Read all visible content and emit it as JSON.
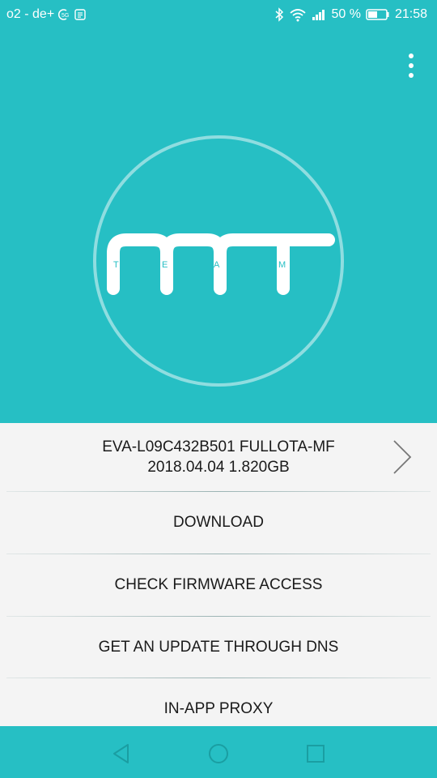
{
  "status_bar": {
    "carrier": "o2 - de+",
    "battery_percent": "50 %",
    "time": "21:58",
    "icons": [
      "hd-call-icon",
      "notification-icon",
      "bluetooth-icon",
      "wifi-icon",
      "signal-icon",
      "battery-icon"
    ]
  },
  "hero": {
    "logo_text": "MT",
    "logo_subtext": [
      "T",
      "E",
      "A",
      "M"
    ],
    "background_color": "#26bfc4"
  },
  "firmware": {
    "name": "EVA-L09C432B501 FULLOTA-MF",
    "details": "2018.04.04 1.820GB"
  },
  "menu": {
    "items": [
      {
        "label": "DOWNLOAD"
      },
      {
        "label": "CHECK FIRMWARE ACCESS"
      },
      {
        "label": "GET AN UPDATE THROUGH DNS"
      },
      {
        "label": "IN-APP PROXY"
      }
    ]
  },
  "nav": {
    "icons": [
      "back-icon",
      "home-icon",
      "recents-icon"
    ]
  }
}
